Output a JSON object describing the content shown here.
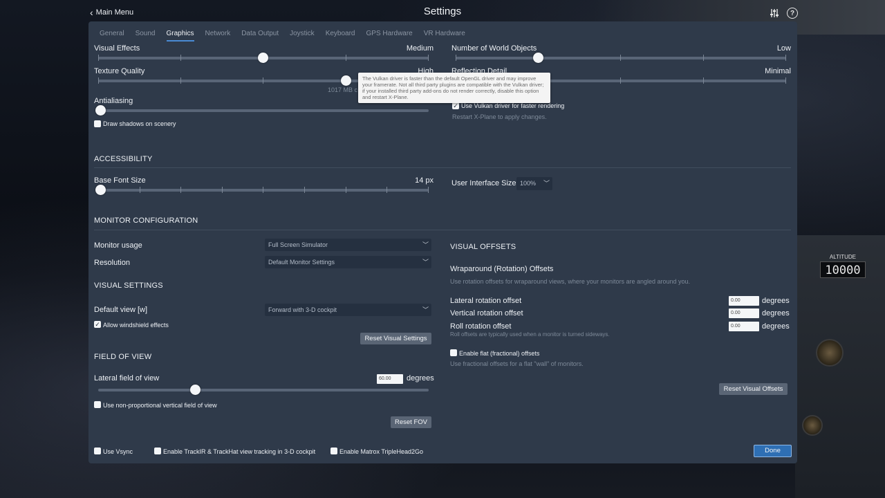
{
  "header": {
    "back_label": "Main Menu",
    "title": "Settings"
  },
  "tabs": [
    "General",
    "Sound",
    "Graphics",
    "Network",
    "Data Output",
    "Joystick",
    "Keyboard",
    "GPS Hardware",
    "VR Hardware"
  ],
  "active_tab": "Graphics",
  "graphics": {
    "visual_effects": {
      "label": "Visual Effects",
      "value": "Medium",
      "level": 0.5
    },
    "texture_quality": {
      "label": "Texture Quality",
      "value": "High",
      "level": 0.75,
      "memory": "1017 MB c"
    },
    "antialiasing": {
      "label": "Antialiasing",
      "level": 0.0
    },
    "draw_shadows": {
      "label": "Draw shadows on scenery",
      "checked": false
    },
    "world_objects": {
      "label": "Number of World Objects",
      "value": "Low",
      "level": 0.25
    },
    "reflection_detail": {
      "label": "Reflection Detail",
      "value": "Minimal",
      "level": 0.0
    },
    "vulkan": {
      "label": "Use Vulkan driver for faster rendering",
      "checked": true,
      "note": "Restart X-Plane to apply changes."
    },
    "tooltip": "The Vulkan driver is faster than the default OpenGL driver and may improve your framerate. Not all third party plugins are compatible with the Vulkan driver; if your installed third party add-ons do not render correctly, disable this option and restart X-Plane."
  },
  "accessibility": {
    "heading": "ACCESSIBILITY",
    "base_font_size": {
      "label": "Base Font Size",
      "value": "14 px",
      "level": 0.0
    },
    "ui_size": {
      "label": "User Interface Size",
      "value": "100%"
    }
  },
  "monitor": {
    "heading": "MONITOR CONFIGURATION",
    "usage_label": "Monitor usage",
    "usage_value": "Full Screen Simulator",
    "resolution_label": "Resolution",
    "resolution_value": "Default Monitor Settings"
  },
  "visual_settings": {
    "heading": "VISUAL SETTINGS",
    "default_view_label": "Default view [w]",
    "default_view_value": "Forward with 3-D cockpit",
    "windshield_label": "Allow windshield effects",
    "windshield_checked": true,
    "reset_label": "Reset Visual Settings"
  },
  "fov": {
    "heading": "FIELD OF VIEW",
    "lateral_label": "Lateral field of view",
    "lateral_value": "60.00",
    "unit": "degrees",
    "level": 0.3,
    "non_proportional_label": "Use non-proportional vertical field of view",
    "non_proportional_checked": false,
    "reset_label": "Reset FOV"
  },
  "visual_offsets": {
    "heading": "VISUAL OFFSETS",
    "wrap_heading": "Wraparound (Rotation) Offsets",
    "wrap_desc": "Use rotation offsets for wraparound views, where your monitors are angled around you.",
    "lateral_label": "Lateral rotation offset",
    "lateral_value": "0.00",
    "vertical_label": "Vertical rotation offset",
    "vertical_value": "0.00",
    "roll_label": "Roll rotation offset",
    "roll_value": "0.00",
    "roll_note": "Roll offsets are typically used when a monitor is turned sideways.",
    "unit": "degrees",
    "flat_label": "Enable flat (fractional) offsets",
    "flat_checked": false,
    "flat_desc": "Use fractional offsets for a flat \"wall\" of monitors.",
    "reset_label": "Reset Visual Offsets"
  },
  "footer": {
    "vsync_label": "Use Vsync",
    "trackir_label": "Enable TrackIR & TrackHat view tracking in 3-D cockpit",
    "matrox_label": "Enable Matrox TripleHead2Go",
    "done_label": "Done"
  },
  "background": {
    "altitude_label": "ALTITUDE",
    "altitude_value": "10000"
  },
  "colors": {
    "panel": "#2f3a4a",
    "accent": "#4a8bd4",
    "done_button": "#2e6fb4"
  }
}
